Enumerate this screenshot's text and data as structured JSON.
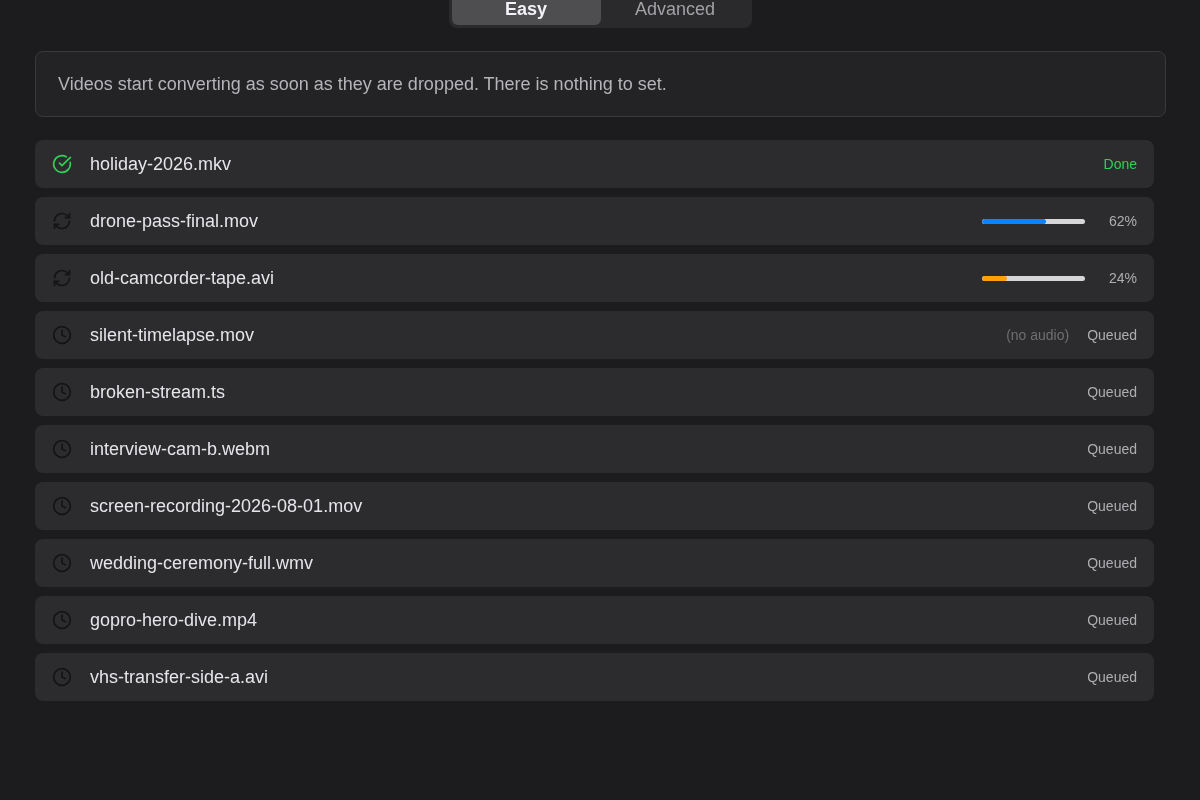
{
  "segmented_control": {
    "tabs": [
      {
        "label": "Easy",
        "selected": true
      },
      {
        "label": "Advanced",
        "selected": false
      }
    ]
  },
  "info_message": "Videos start converting as soon as they are dropped. There is nothing to set.",
  "files": [
    {
      "name": "holiday-2026.mkv",
      "kind": "done",
      "status": "Done"
    },
    {
      "name": "drone-pass-final.mov",
      "kind": "converting",
      "level": 0.62,
      "color": "#0a84ff",
      "reading": "62%"
    },
    {
      "name": "old-camcorder-tape.avi",
      "kind": "converting",
      "level": 0.24,
      "color": "#ff9f0a",
      "reading": "24%"
    },
    {
      "name": "silent-timelapse.mov",
      "kind": "queued",
      "note": "(no audio)",
      "status": "Queued"
    },
    {
      "name": "broken-stream.ts",
      "kind": "queued",
      "status": "Queued"
    },
    {
      "name": "interview-cam-b.webm",
      "kind": "queued",
      "status": "Queued"
    },
    {
      "name": "screen-recording-2026-08-01.mov",
      "kind": "queued",
      "status": "Queued"
    },
    {
      "name": "wedding-ceremony-full.wmv",
      "kind": "queued",
      "status": "Queued"
    },
    {
      "name": "gopro-hero-dive.mp4",
      "kind": "queued",
      "status": "Queued"
    },
    {
      "name": "vhs-transfer-side-a.avi",
      "kind": "queued",
      "status": "Queued"
    }
  ]
}
